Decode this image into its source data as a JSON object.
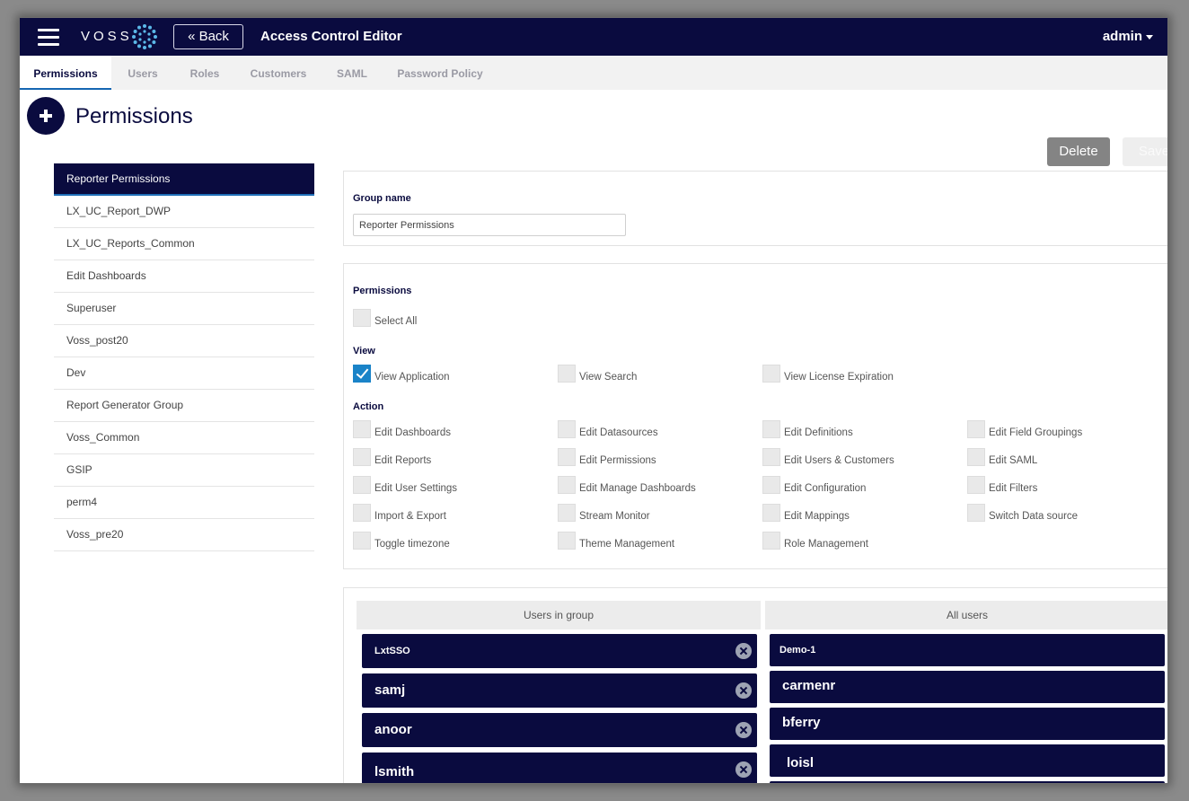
{
  "header": {
    "logo_text": "VOSS",
    "back_label": "« Back",
    "title": "Access Control Editor",
    "user": "admin"
  },
  "tabs": [
    {
      "label": "Permissions",
      "active": true
    },
    {
      "label": "Users"
    },
    {
      "label": "Roles"
    },
    {
      "label": "Customers"
    },
    {
      "label": "SAML"
    },
    {
      "label": "Password Policy"
    }
  ],
  "page": {
    "title": "Permissions",
    "delete_label": "Delete",
    "save_label": "Save"
  },
  "groups": [
    "Reporter Permissions",
    "LX_UC_Report_DWP",
    "LX_UC_Reports_Common",
    "Edit Dashboards",
    "Superuser",
    "Voss_post20",
    "Dev",
    "Report Generator Group",
    "Voss_Common",
    "GSIP",
    "perm4",
    "Voss_pre20"
  ],
  "group_name": {
    "label": "Group name",
    "value": "Reporter Permissions"
  },
  "permissions": {
    "label": "Permissions",
    "select_all": "Select All",
    "view_label": "View",
    "view": [
      {
        "label": "View Application",
        "checked": true
      },
      {
        "label": "View Search",
        "checked": false
      },
      {
        "label": "View License Expiration",
        "checked": false
      }
    ],
    "action_label": "Action",
    "action": [
      {
        "label": "Edit Dashboards",
        "checked": false
      },
      {
        "label": "Edit Datasources",
        "checked": false
      },
      {
        "label": "Edit Definitions",
        "checked": false
      },
      {
        "label": "Edit Field Groupings",
        "checked": false
      },
      {
        "label": "Edit Reports",
        "checked": false
      },
      {
        "label": "Edit Permissions",
        "checked": false
      },
      {
        "label": "Edit Users & Customers",
        "checked": false
      },
      {
        "label": "Edit SAML",
        "checked": false
      },
      {
        "label": "Edit User Settings",
        "checked": false
      },
      {
        "label": "Edit Manage Dashboards",
        "checked": false
      },
      {
        "label": "Edit Configuration",
        "checked": false
      },
      {
        "label": "Edit Filters",
        "checked": false
      },
      {
        "label": "Import & Export",
        "checked": false
      },
      {
        "label": "Stream Monitor",
        "checked": false
      },
      {
        "label": "Edit Mappings",
        "checked": false
      },
      {
        "label": "Switch Data source",
        "checked": false
      },
      {
        "label": "Toggle timezone",
        "checked": false
      },
      {
        "label": "Theme Management",
        "checked": false
      },
      {
        "label": "Role Management",
        "checked": false
      }
    ]
  },
  "users_in_group": {
    "header": "Users in group",
    "users": [
      "LxtSSO",
      "samj",
      "anoor",
      "lsmith"
    ]
  },
  "all_users": {
    "header": "All users",
    "users": [
      "Demo-1",
      "carmenr",
      "bferry",
      "loisl"
    ]
  }
}
